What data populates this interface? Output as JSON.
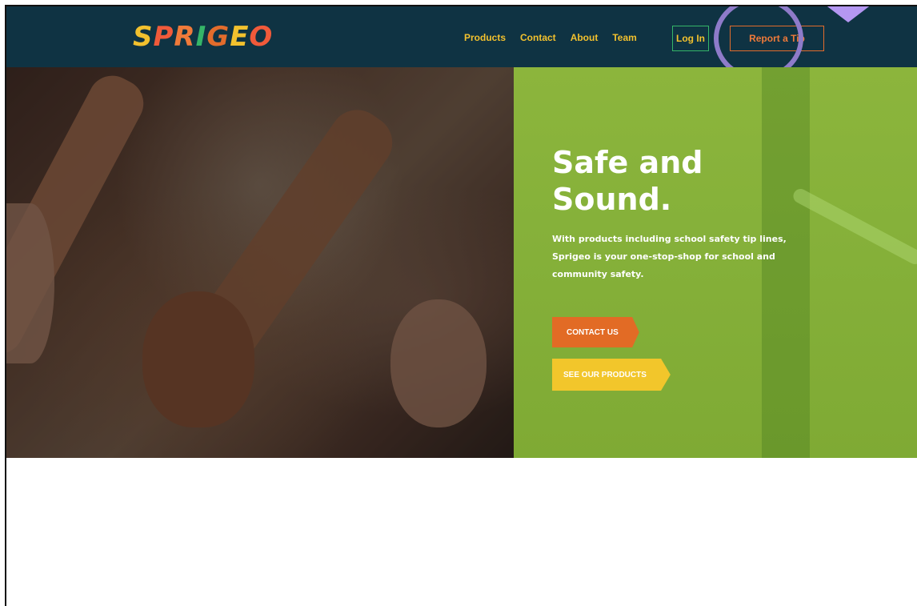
{
  "brand": {
    "logo_text": "SPRIGEO",
    "logo_letters": [
      "S",
      "P",
      "R",
      "I",
      "G",
      "E",
      "O"
    ],
    "logo_colors": [
      "#f2c12e",
      "#f05a3a",
      "#ef7a3a",
      "#35b568",
      "#e26c2c",
      "#f2c12e",
      "#f05a3a"
    ]
  },
  "nav": {
    "links": [
      "Products",
      "Contact",
      "About",
      "Team"
    ],
    "login_label": "Log In",
    "report_label": "Report a Tip"
  },
  "hero": {
    "title": "Safe and Sound.",
    "subtitle": "With products including school safety tip lines, Sprigeo is your one-stop-shop for school and community safety.",
    "contact_button": "CONTACT US",
    "products_button": "SEE OUR PRODUCTS"
  },
  "colors": {
    "navbar": "#0f3343",
    "nav_text": "#f2c12e",
    "hero_green": "#86b13a",
    "contact_orange": "#e26b25",
    "products_yellow": "#f2c62b",
    "highlight": "#8e7bc9"
  }
}
